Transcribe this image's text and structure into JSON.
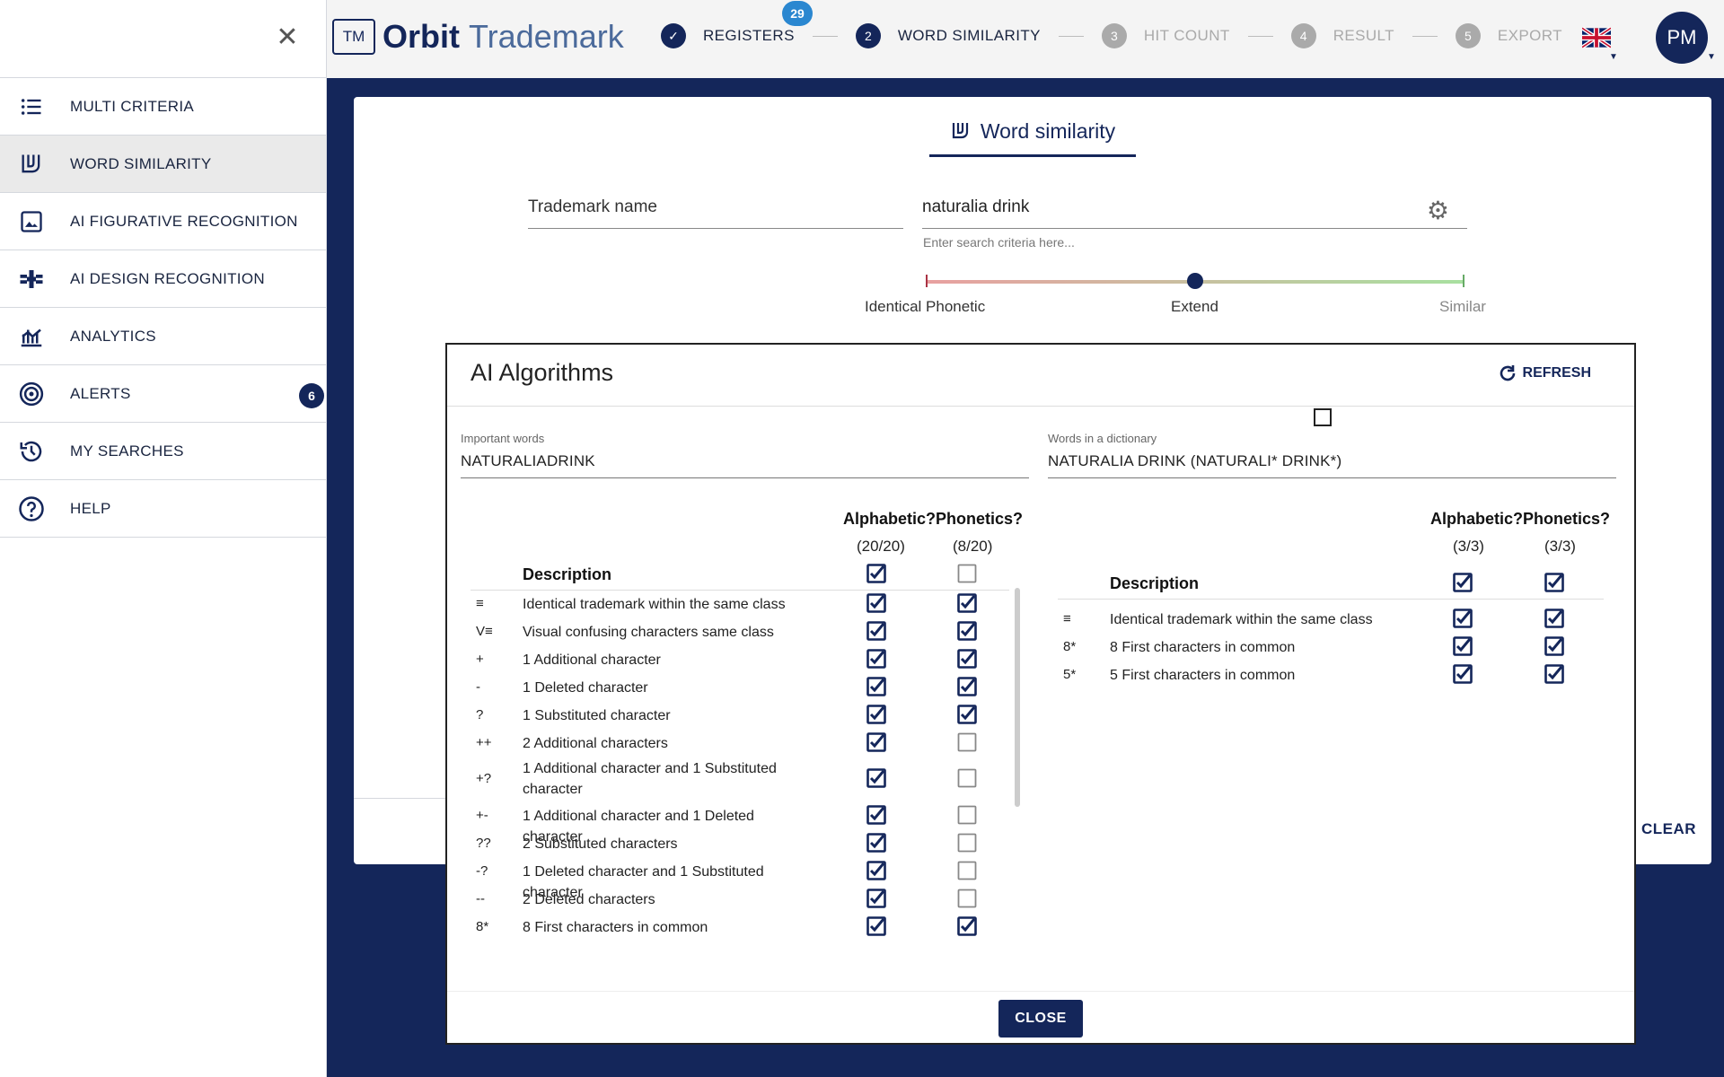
{
  "sidebar": {
    "items": [
      {
        "label": "MULTI CRITERIA",
        "icon": "list-icon"
      },
      {
        "label": "WORD SIMILARITY",
        "icon": "word-similarity-icon",
        "active": true
      },
      {
        "label": "AI FIGURATIVE RECOGNITION",
        "icon": "image-icon"
      },
      {
        "label": "AI DESIGN RECOGNITION",
        "icon": "satellite-icon"
      },
      {
        "label": "ANALYTICS",
        "icon": "analytics-icon"
      },
      {
        "label": "ALERTS",
        "icon": "target-icon",
        "badge": "6"
      },
      {
        "label": "MY SEARCHES",
        "icon": "history-icon"
      },
      {
        "label": "HELP",
        "icon": "help-icon"
      }
    ]
  },
  "header": {
    "logo_tm": "TM",
    "logo_orbit": "Orbit",
    "logo_trademark": "Trademark",
    "steps": [
      {
        "num": "✓",
        "label": "REGISTERS",
        "badge": "29",
        "done": true
      },
      {
        "num": "2",
        "label": "WORD SIMILARITY",
        "active": true
      },
      {
        "num": "3",
        "label": "HIT COUNT"
      },
      {
        "num": "4",
        "label": "RESULT"
      },
      {
        "num": "5",
        "label": "EXPORT"
      }
    ],
    "avatar": "PM"
  },
  "page": {
    "tab_label": "Word similarity",
    "trademark_label": "Trademark name",
    "search_value": "naturalia drink",
    "search_hint": "Enter search criteria here...",
    "slider": {
      "left": "Identical Phonetic",
      "middle": "Extend",
      "right": "Similar",
      "value": "Extend"
    },
    "clear_label": "CLEAR"
  },
  "dialog": {
    "title": "AI Algorithms",
    "refresh_label": "REFRESH",
    "close_label": "CLOSE",
    "left": {
      "field_label": "Important words",
      "field_value": "NATURALIADRINK",
      "alpha_head": "Alphabetic?",
      "phon_head": "Phonetics?",
      "alpha_count": "(20/20)",
      "phon_count": "(8/20)",
      "desc_head": "Description",
      "header_alpha": true,
      "header_phon": false,
      "rows": [
        {
          "sym": "≡",
          "desc": "Identical trademark within the same class",
          "a": true,
          "p": true
        },
        {
          "sym": "V≡",
          "desc": "Visual confusing characters same class",
          "a": true,
          "p": true
        },
        {
          "sym": "+",
          "desc": "1 Additional character",
          "a": true,
          "p": true
        },
        {
          "sym": "-",
          "desc": "1 Deleted character",
          "a": true,
          "p": true
        },
        {
          "sym": "?",
          "desc": "1 Substituted character",
          "a": true,
          "p": true
        },
        {
          "sym": "++",
          "desc": "2 Additional characters",
          "a": true,
          "p": false
        },
        {
          "sym": "+?",
          "desc": "1 Additional character and 1 Substituted character",
          "a": true,
          "p": false
        },
        {
          "sym": "+-",
          "desc": "1 Additional character and 1 Deleted character",
          "a": true,
          "p": false
        },
        {
          "sym": "??",
          "desc": "2 Substituted characters",
          "a": true,
          "p": false
        },
        {
          "sym": "-?",
          "desc": "1 Deleted character and 1 Substituted character",
          "a": true,
          "p": false
        },
        {
          "sym": "--",
          "desc": "2 Deleted characters",
          "a": true,
          "p": false
        },
        {
          "sym": "8*",
          "desc": "8 First characters in common",
          "a": true,
          "p": true
        }
      ]
    },
    "right": {
      "field_label": "Words in a dictionary",
      "field_value": "NATURALIA DRINK (NATURALI* DRINK*)",
      "alpha_head": "Alphabetic?",
      "phon_head": "Phonetics?",
      "alpha_count": "(3/3)",
      "phon_count": "(3/3)",
      "desc_head": "Description",
      "header_alpha": true,
      "header_phon": true,
      "rows": [
        {
          "sym": "≡",
          "desc": "Identical trademark within the same class",
          "a": true,
          "p": true
        },
        {
          "sym": "8*",
          "desc": "8 First characters in common",
          "a": true,
          "p": true
        },
        {
          "sym": "5*",
          "desc": "5 First characters in common",
          "a": true,
          "p": true
        }
      ]
    }
  }
}
